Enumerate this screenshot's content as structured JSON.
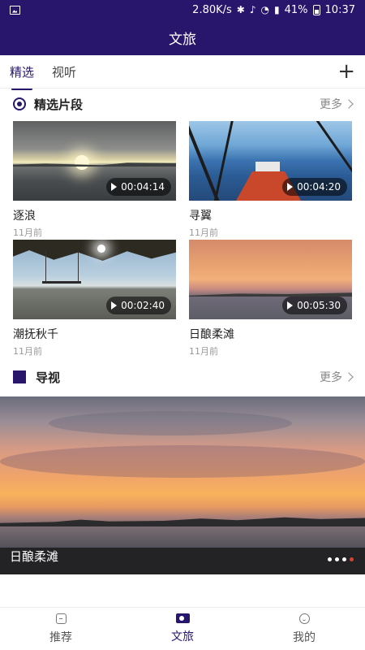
{
  "status_bar": {
    "speed": "2.80K/s",
    "battery": "41%",
    "time": "10:37",
    "icons": [
      "image-icon",
      "bluetooth-icon",
      "mute-icon",
      "wifi-icon",
      "signal-icon",
      "battery-icon"
    ]
  },
  "header": {
    "title": "文旅"
  },
  "tabs": [
    {
      "label": "精选",
      "active": true
    },
    {
      "label": "视听",
      "active": false
    }
  ],
  "add_icon": "plus-icon",
  "featured": {
    "title": "精选片段",
    "more": "更多",
    "items": [
      {
        "title": "逐浪",
        "time": "11月前",
        "duration": "00:04:14"
      },
      {
        "title": "寻翼",
        "time": "11月前",
        "duration": "00:04:20"
      },
      {
        "title": "潮抚秋千",
        "time": "11月前",
        "duration": "00:02:40"
      },
      {
        "title": "日酿柔滩",
        "time": "11月前",
        "duration": "00:05:30"
      }
    ]
  },
  "guide": {
    "title": "导视",
    "more": "更多",
    "banner": {
      "title": "日酿柔滩",
      "slide_count": 4,
      "active_slide": 4
    }
  },
  "bottom_nav": [
    {
      "label": "推荐",
      "icon": "home-icon",
      "active": false
    },
    {
      "label": "文旅",
      "icon": "video-camera-icon",
      "active": true
    },
    {
      "label": "我的",
      "icon": "user-icon",
      "active": false
    }
  ],
  "colors": {
    "brand": "#27166b",
    "slide_dot_active": "#e0402a"
  }
}
